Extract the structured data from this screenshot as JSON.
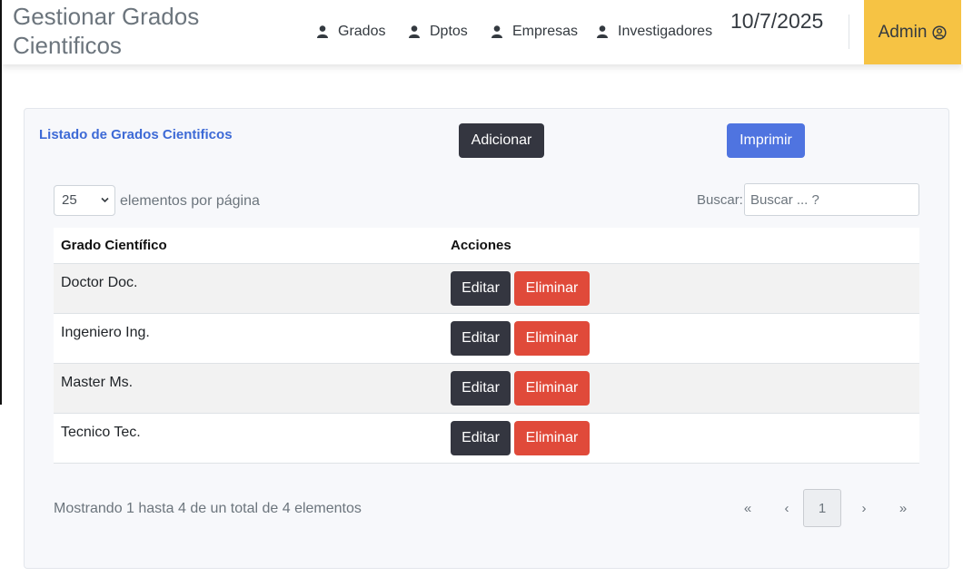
{
  "header": {
    "title": "Gestionar Grados Cientificos",
    "nav": [
      {
        "label": "Grados",
        "icon": "user-icon"
      },
      {
        "label": "Dptos",
        "icon": "user-icon"
      },
      {
        "label": "Empresas",
        "icon": "user-icon"
      },
      {
        "label": "Investigadores",
        "icon": "user-icon"
      }
    ],
    "date": "10/7/2025",
    "user_label": "Admin",
    "user_icon": "user-circle-icon",
    "accent_color": "#f6c344"
  },
  "card": {
    "title": "Listado de Grados Cientificos",
    "add_label": "Adicionar",
    "print_label": "Imprimir",
    "page_size": "25",
    "per_page_label": "elementos por página",
    "search_label": "Buscar:",
    "search_placeholder": "Buscar ... ?",
    "search_value": ""
  },
  "table": {
    "columns": [
      "Grado Científico",
      "Acciones"
    ],
    "edit_label": "Editar",
    "delete_label": "Eliminar",
    "rows": [
      "Doctor Doc.",
      "Ingeniero Ing.",
      "Master Ms.",
      "Tecnico Tec."
    ]
  },
  "footer": {
    "info": "Mostrando 1 hasta 4 de un total de 4 elementos",
    "pager": {
      "first": "«",
      "prev": "‹",
      "current": "1",
      "next": "›",
      "last": "»"
    }
  }
}
